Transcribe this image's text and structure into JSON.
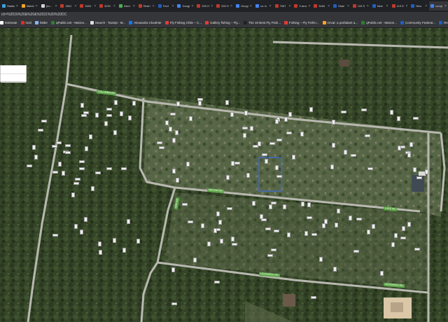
{
  "browser": {
    "tabs": [
      {
        "label": "Stadiu",
        "color": "#3aa0e0"
      },
      {
        "label": "Matrix",
        "color": "#f5a623"
      },
      {
        "label": "(no...",
        "color": "#d4d4d4"
      },
      {
        "label": "3341",
        "color": "#c0392b"
      },
      {
        "label": "3494",
        "color": "#c0392b"
      },
      {
        "label": "3291",
        "color": "#c0392b"
      },
      {
        "label": "Interr",
        "color": "#4caf50"
      },
      {
        "label": "Real I",
        "color": "#c0392b"
      },
      {
        "label": "Ford",
        "color": "#1f5fbf"
      },
      {
        "label": "Googl",
        "color": "#4285f4"
      },
      {
        "label": "333 H",
        "color": "#c0392b"
      },
      {
        "label": "333 H",
        "color": "#c0392b"
      },
      {
        "label": "Googl",
        "color": "#4285f4"
      },
      {
        "label": "vo: lo",
        "color": "#4285f4"
      },
      {
        "label": "7067",
        "color": "#c0392b"
      },
      {
        "label": "3 arra",
        "color": "#c0392b"
      },
      {
        "label": "3494",
        "color": "#c0392b"
      },
      {
        "label": "Sharl",
        "color": "#1f5fbf"
      },
      {
        "label": "119 S",
        "color": "#c0392b"
      },
      {
        "label": "New",
        "color": "#1f5fbf"
      },
      {
        "label": "119 S",
        "color": "#c0392b"
      },
      {
        "label": "New",
        "color": "#1f5fbf"
      },
      {
        "label": "comp",
        "color": "#4285f4"
      }
    ],
    "active_tab_index": 22,
    "url": "ch=%2016%20&%20&%2021%20%20DC"
  },
  "bookmarks": [
    {
      "label": "Estimate",
      "color": "#ffffff"
    },
    {
      "label": "mail",
      "color": "#d93025"
    },
    {
      "label": "folder",
      "color": "#8ab4f8"
    },
    {
      "label": "qPublic.net - Marion...",
      "color": "#2e7d32"
    },
    {
      "label": "Search - TaxSpt - M...",
      "color": "#e0e0e0"
    },
    {
      "label": "Alexandra Clouthier",
      "color": "#1877f2"
    },
    {
      "label": "Fly Fishing Chile – C...",
      "color": "#e53935"
    },
    {
      "label": "Gallery fishing – Fly...",
      "color": "#e53935"
    },
    {
      "label": "The 10 Best Fly Fishi...",
      "color": "#212121"
    },
    {
      "label": "Fishing – Fly Fishin...",
      "color": "#e53935"
    },
    {
      "label": "Orvat: a parfaitant a...",
      "color": "#f5a623"
    },
    {
      "label": "qPublic.net - Marion...",
      "color": "#2e7d32"
    },
    {
      "label": "Community Federat...",
      "color": "#1f5fbf"
    },
    {
      "label": "RealForeclose - Mari...",
      "color": "#1f5fbf"
    }
  ],
  "map": {
    "street_labels": [
      "COLUMBIA RD",
      "MARION RD",
      "LAKE RD",
      "OAK RD",
      "LEONARDO RD",
      "LEONARDO RD"
    ],
    "colors": {
      "aerial_base": "#3c4a2f",
      "road": "#b8b8b0",
      "highlight_parcel": "#3a6cff",
      "street_label_bg": "#5ba545"
    }
  }
}
